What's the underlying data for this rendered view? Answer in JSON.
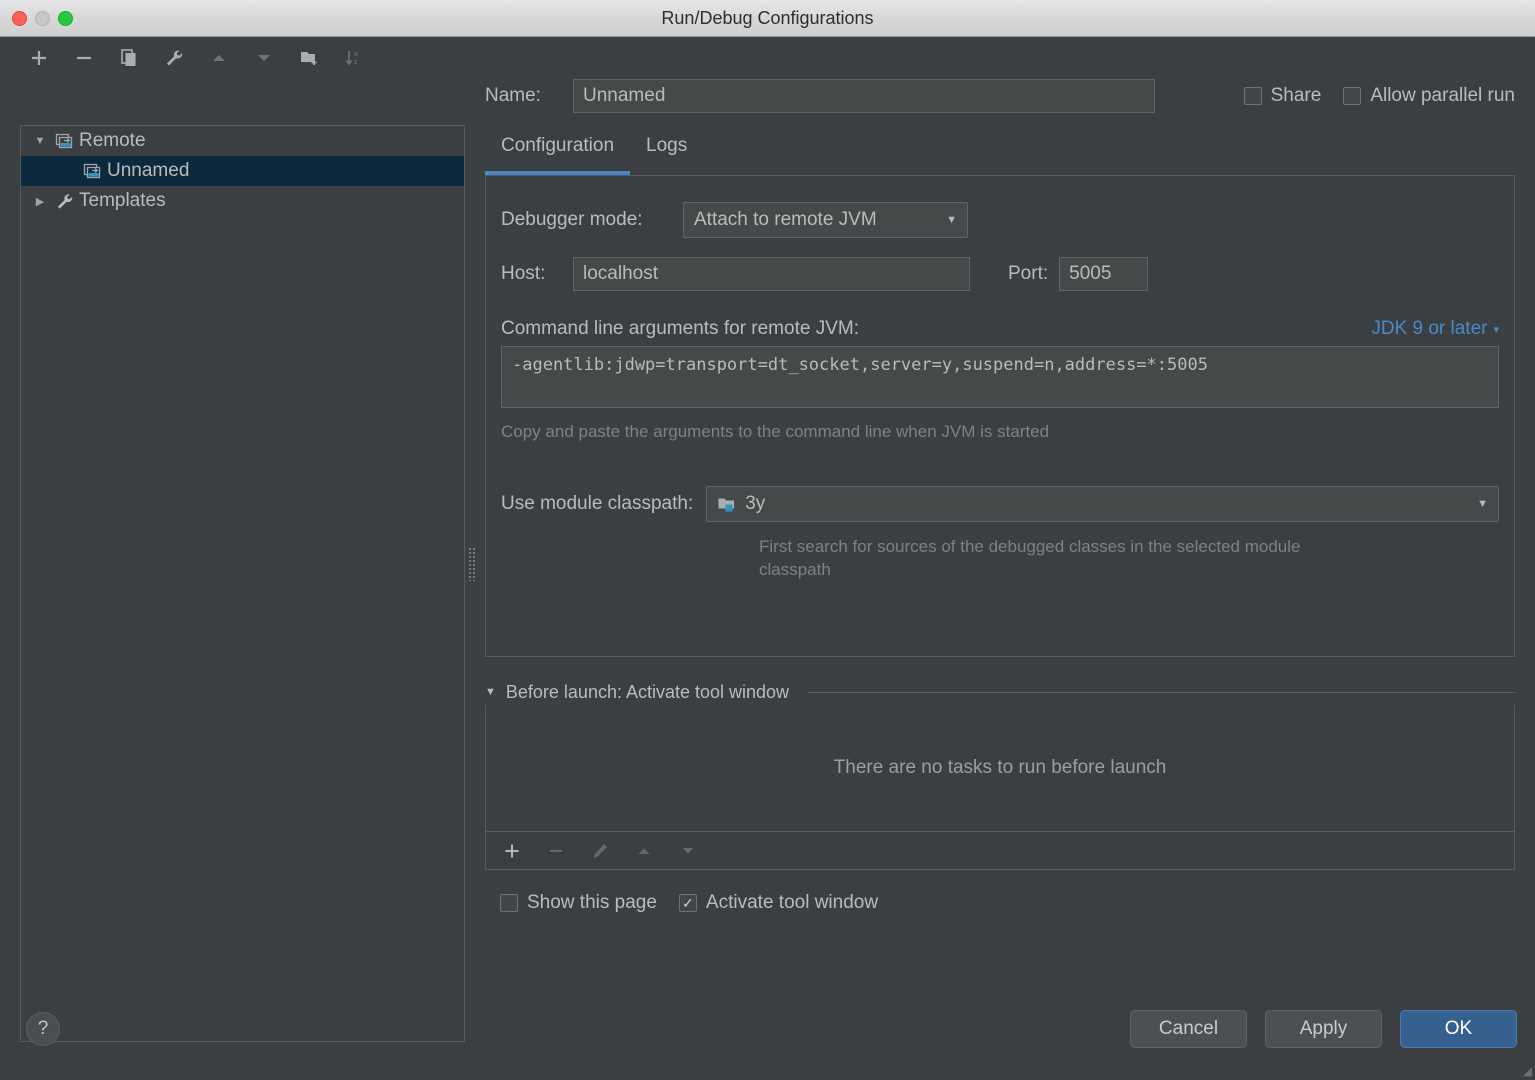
{
  "window": {
    "title": "Run/Debug Configurations"
  },
  "sidebar": {
    "toolbar": [
      {
        "name": "add-configuration-button",
        "icon": "plus-icon",
        "enabled": true
      },
      {
        "name": "remove-configuration-button",
        "icon": "minus-icon",
        "enabled": true
      },
      {
        "name": "copy-configuration-button",
        "icon": "copy-icon",
        "enabled": true
      },
      {
        "name": "edit-templates-button",
        "icon": "wrench-icon",
        "enabled": true
      },
      {
        "name": "move-up-button",
        "icon": "arrow-up-icon",
        "enabled": false
      },
      {
        "name": "move-down-button",
        "icon": "arrow-down-icon",
        "enabled": false
      },
      {
        "name": "new-folder-button",
        "icon": "folder-add-icon",
        "enabled": true
      },
      {
        "name": "sort-alphabetically-button",
        "icon": "sort-az-icon",
        "enabled": false
      }
    ],
    "tree": [
      {
        "label": "Remote",
        "icon": "remote-config-icon",
        "twisty": "▼",
        "level": 0,
        "selected": false
      },
      {
        "label": "Unnamed",
        "icon": "remote-config-icon",
        "twisty": "",
        "level": 1,
        "selected": true
      },
      {
        "label": "Templates",
        "icon": "wrench-icon",
        "twisty": "▶",
        "level": 0,
        "selected": false
      }
    ]
  },
  "header": {
    "name_label": "Name:",
    "name_value": "Unnamed",
    "share_label": "Share",
    "share_checked": false,
    "parallel_label": "Allow parallel run",
    "parallel_checked": false
  },
  "tabs": [
    {
      "label": "Configuration",
      "active": true
    },
    {
      "label": "Logs",
      "active": false
    }
  ],
  "configuration": {
    "debugger_mode_label": "Debugger mode:",
    "debugger_mode_value": "Attach to remote JVM",
    "host_label": "Host:",
    "host_value": "localhost",
    "port_label": "Port:",
    "port_value": "5005",
    "cmd_label": "Command line arguments for remote JVM:",
    "jdk_link": "JDK 9 or later",
    "cmd_value": "-agentlib:jdwp=transport=dt_socket,server=y,suspend=n,address=*:5005",
    "cmd_hint": "Copy and paste the arguments to the command line when JVM is started",
    "classpath_label": "Use module classpath:",
    "classpath_value": "3y",
    "classpath_hint": "First search for sources of the debugged classes in the selected module classpath"
  },
  "before_launch": {
    "title": "Before launch: Activate tool window",
    "twisty": "▼",
    "empty_text": "There are no tasks to run before launch",
    "toolbar": [
      {
        "name": "add-task-button",
        "icon": "plus-icon",
        "enabled": true
      },
      {
        "name": "remove-task-button",
        "icon": "minus-icon",
        "enabled": false
      },
      {
        "name": "edit-task-button",
        "icon": "pencil-icon",
        "enabled": false
      },
      {
        "name": "task-move-up-button",
        "icon": "arrow-up-icon",
        "enabled": false
      },
      {
        "name": "task-move-down-button",
        "icon": "arrow-down-icon",
        "enabled": false
      }
    ],
    "show_page_label": "Show this page",
    "show_page_checked": false,
    "activate_label": "Activate tool window",
    "activate_checked": true,
    "check_glyph": "✓"
  },
  "footer": {
    "help_label": "?",
    "cancel_label": "Cancel",
    "apply_label": "Apply",
    "ok_label": "OK"
  },
  "colors": {
    "background": "#3c3f41",
    "panel_border": "#555a5c",
    "input_bg": "#45494a",
    "accent_blue": "#4a88c7",
    "selection_bg": "#0d293e",
    "primary_button": "#36618e",
    "text": "#bbbbbb",
    "muted_text": "#7c8184"
  }
}
